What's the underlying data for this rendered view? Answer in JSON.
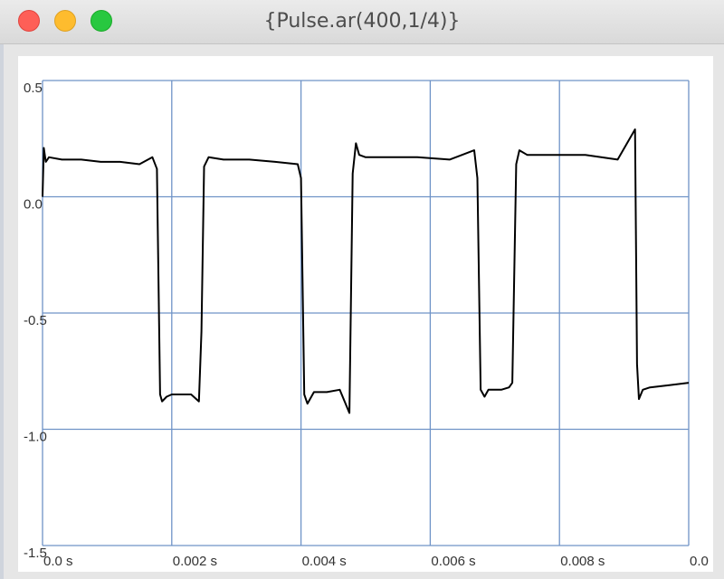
{
  "window": {
    "title": "{Pulse.ar(400,1/4)}"
  },
  "colors": {
    "grid": "#6f93c7",
    "signal": "#000000",
    "background": "#ffffff"
  },
  "chart_data": {
    "type": "line",
    "title": "",
    "xlabel": "",
    "ylabel": "",
    "xlim": [
      0,
      0.01
    ],
    "ylim": [
      -1.5,
      0.5
    ],
    "grid": true,
    "x_ticks": [
      {
        "value": 0,
        "label": "0.0 s"
      },
      {
        "value": 0.002,
        "label": "0.002 s"
      },
      {
        "value": 0.004,
        "label": "0.004 s"
      },
      {
        "value": 0.006,
        "label": "0.006 s"
      },
      {
        "value": 0.008,
        "label": "0.008 s"
      },
      {
        "value": 0.01,
        "label": "0.0"
      }
    ],
    "y_ticks": [
      {
        "value": 0.5,
        "label": "0.5"
      },
      {
        "value": 0.0,
        "label": "0.0"
      },
      {
        "value": -0.5,
        "label": "-0.5"
      },
      {
        "value": -1.0,
        "label": "-1.0"
      },
      {
        "value": -1.5,
        "label": "-1.5"
      }
    ],
    "series": [
      {
        "x": [
          0,
          2e-05,
          5e-05,
          0.0001,
          0.0003,
          0.0006,
          0.0009,
          0.0012,
          0.0015,
          0.0017,
          0.00177,
          0.00182,
          0.00185,
          0.00192,
          0.002,
          0.0023,
          0.00242,
          0.00246,
          0.0025,
          0.00257,
          0.0028,
          0.0032,
          0.0036,
          0.00395,
          0.004,
          0.00405,
          0.0041,
          0.0042,
          0.0044,
          0.0046,
          0.00475,
          0.0048,
          0.00485,
          0.0049,
          0.005,
          0.0053,
          0.0058,
          0.0063,
          0.00668,
          0.00673,
          0.00678,
          0.00684,
          0.0069,
          0.0071,
          0.00722,
          0.00727,
          0.00733,
          0.00738,
          0.0075,
          0.0079,
          0.0084,
          0.0089,
          0.00917,
          0.0092,
          0.00923,
          0.00929,
          0.0094,
          0.0097,
          0.01
        ],
        "y": [
          0.0,
          0.21,
          0.15,
          0.17,
          0.16,
          0.16,
          0.15,
          0.15,
          0.14,
          0.17,
          0.12,
          -0.85,
          -0.88,
          -0.86,
          -0.85,
          -0.85,
          -0.88,
          -0.58,
          0.13,
          0.17,
          0.16,
          0.16,
          0.15,
          0.14,
          0.08,
          -0.85,
          -0.89,
          -0.84,
          -0.84,
          -0.83,
          -0.93,
          0.1,
          0.23,
          0.18,
          0.17,
          0.17,
          0.17,
          0.16,
          0.2,
          0.08,
          -0.83,
          -0.86,
          -0.83,
          -0.83,
          -0.82,
          -0.8,
          0.14,
          0.2,
          0.18,
          0.18,
          0.18,
          0.16,
          0.29,
          -0.72,
          -0.87,
          -0.83,
          -0.82,
          -0.81,
          -0.8
        ]
      }
    ]
  }
}
